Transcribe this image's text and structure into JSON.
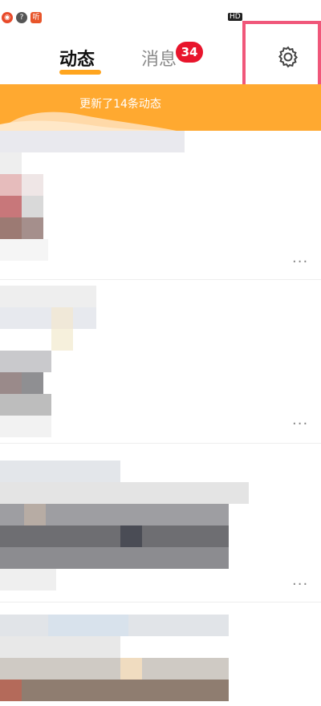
{
  "tabs": {
    "active_label": "动态",
    "inactive_label": "消息",
    "badge_count": "34"
  },
  "banner": {
    "text": "更新了14条动态"
  },
  "status_bar": {
    "hd": "HD"
  },
  "colors": {
    "accent": "#ffa51f",
    "banner": "#ffa930",
    "badge": "#e8152c",
    "highlight": "#f0577a"
  },
  "icons": [
    "app-icon-1",
    "app-icon-2",
    "app-icon-3",
    "settings-gear-icon",
    "more-icon"
  ],
  "posts": [
    {
      "more": "···"
    },
    {
      "more": "···"
    },
    {
      "more": "···"
    }
  ]
}
